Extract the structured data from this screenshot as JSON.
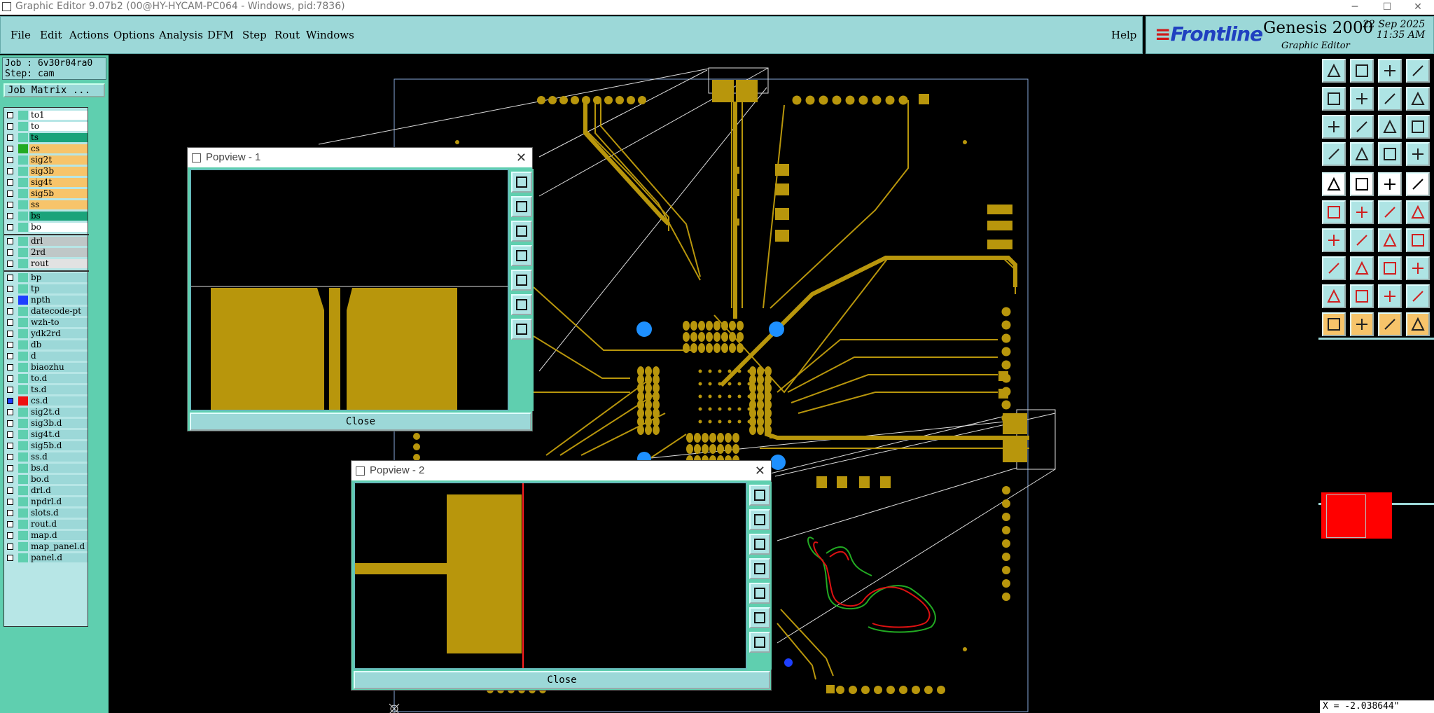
{
  "window": {
    "title": "Graphic Editor 9.07b2 (00@HY-HYCAM-PC064 - Windows, pid:7836)",
    "minimize": "─",
    "maximize": "☐",
    "close": "✕"
  },
  "menubar": {
    "items": [
      "File",
      "Edit",
      "Actions",
      "Options",
      "Analysis",
      "DFM",
      "Step",
      "Rout",
      "Windows"
    ],
    "help": "Help"
  },
  "branding": {
    "company": "Frontline",
    "product": "Genesis 2000",
    "subtitle": "Graphic Editor",
    "date": "22 Sep 2025",
    "time": "11:35 AM"
  },
  "job": {
    "job_line": "Job : 6v30r04ra0",
    "step_line": "Step: cam",
    "matrix_button": "Job Matrix ..."
  },
  "layers": [
    {
      "name": "to1",
      "color": "#ffffff",
      "swatch": ""
    },
    {
      "name": "to",
      "color": "#ffffff",
      "swatch": ""
    },
    {
      "name": "ts",
      "color": "#1aa37a",
      "swatch": ""
    },
    {
      "name": "cs",
      "color": "#f7c46a",
      "swatch": "#22aa22"
    },
    {
      "name": "sig2t",
      "color": "#f7c46a",
      "swatch": ""
    },
    {
      "name": "sig3b",
      "color": "#f7c46a",
      "swatch": ""
    },
    {
      "name": "sig4t",
      "color": "#f7c46a",
      "swatch": ""
    },
    {
      "name": "sig5b",
      "color": "#f7c46a",
      "swatch": ""
    },
    {
      "name": "ss",
      "color": "#f7c46a",
      "swatch": ""
    },
    {
      "name": "bs",
      "color": "#1aa37a",
      "swatch": ""
    },
    {
      "name": "bo",
      "color": "#ffffff",
      "swatch": ""
    },
    {
      "name": "drl",
      "color": "#bfc7c7",
      "swatch": "",
      "sep_before": true
    },
    {
      "name": "2rd",
      "color": "#bfc7c7",
      "swatch": ""
    },
    {
      "name": "rout",
      "color": "#e2e2e2",
      "swatch": ""
    },
    {
      "name": "bp",
      "color": "#9cd8d8",
      "swatch": "",
      "sep_before": true
    },
    {
      "name": "tp",
      "color": "#9cd8d8",
      "swatch": ""
    },
    {
      "name": "npth",
      "color": "#9cd8d8",
      "swatch": "#1f3fff"
    },
    {
      "name": "datecode-pt",
      "color": "#9cd8d8",
      "swatch": ""
    },
    {
      "name": "wzh-to",
      "color": "#9cd8d8",
      "swatch": ""
    },
    {
      "name": "ydk2rd",
      "color": "#9cd8d8",
      "swatch": ""
    },
    {
      "name": "db",
      "color": "#9cd8d8",
      "swatch": ""
    },
    {
      "name": "d",
      "color": "#9cd8d8",
      "swatch": ""
    },
    {
      "name": "biaozhu",
      "color": "#9cd8d8",
      "swatch": ""
    },
    {
      "name": "to.d",
      "color": "#9cd8d8",
      "swatch": ""
    },
    {
      "name": "ts.d",
      "color": "#9cd8d8",
      "swatch": ""
    },
    {
      "name": "cs.d",
      "color": "#9cd8d8",
      "swatch": "#ee1111",
      "active": true
    },
    {
      "name": "sig2t.d",
      "color": "#9cd8d8",
      "swatch": ""
    },
    {
      "name": "sig3b.d",
      "color": "#9cd8d8",
      "swatch": ""
    },
    {
      "name": "sig4t.d",
      "color": "#9cd8d8",
      "swatch": ""
    },
    {
      "name": "sig5b.d",
      "color": "#9cd8d8",
      "swatch": ""
    },
    {
      "name": "ss.d",
      "color": "#9cd8d8",
      "swatch": ""
    },
    {
      "name": "bs.d",
      "color": "#9cd8d8",
      "swatch": ""
    },
    {
      "name": "bo.d",
      "color": "#9cd8d8",
      "swatch": ""
    },
    {
      "name": "drl.d",
      "color": "#9cd8d8",
      "swatch": ""
    },
    {
      "name": "npdrl.d",
      "color": "#9cd8d8",
      "swatch": ""
    },
    {
      "name": "slots.d",
      "color": "#9cd8d8",
      "swatch": ""
    },
    {
      "name": "rout.d",
      "color": "#9cd8d8",
      "swatch": ""
    },
    {
      "name": "map.d",
      "color": "#9cd8d8",
      "swatch": ""
    },
    {
      "name": "map_panel.d",
      "color": "#9cd8d8",
      "swatch": ""
    },
    {
      "name": "panel.d",
      "color": "#9cd8d8",
      "swatch": ""
    }
  ],
  "popview1": {
    "title": "Popview - 1",
    "close_label": "Close"
  },
  "popview2": {
    "title": "Popview - 2",
    "close_label": "Close"
  },
  "status": {
    "coordinate": "X = -2.038644\""
  },
  "colors": {
    "copper": "#b8960c",
    "accent_teal": "#5fcfaf",
    "panel_cyan": "#9cd8d8",
    "drill_blue": "#1e90ff",
    "overlay_red": "#ff0000",
    "silk_green": "#22aa22"
  }
}
